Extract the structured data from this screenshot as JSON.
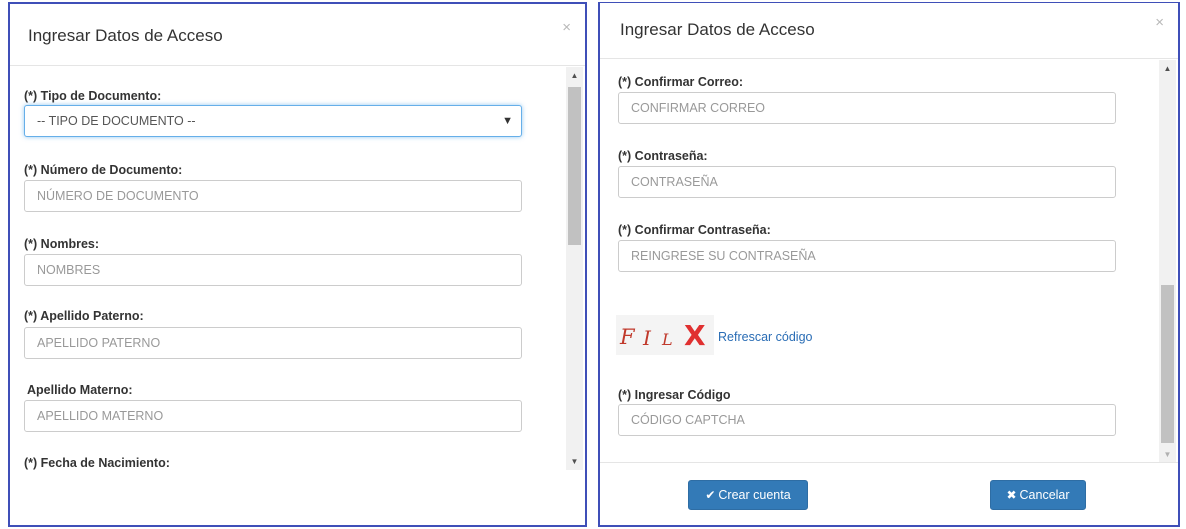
{
  "left_modal": {
    "title": "Ingresar Datos de Acceso",
    "close_glyph": "×",
    "fields": [
      {
        "label": "(*) Tipo de Documento:",
        "placeholder": "-- TIPO DE DOCUMENTO --"
      },
      {
        "label": "(*) Número de Documento:",
        "placeholder": "NÚMERO DE DOCUMENTO"
      },
      {
        "label": "(*) Nombres:",
        "placeholder": "NOMBRES"
      },
      {
        "label": "(*) Apellido Paterno:",
        "placeholder": "APELLIDO PATERNO"
      },
      {
        "label": "Apellido Materno:",
        "placeholder": "APELLIDO MATERNO"
      },
      {
        "label": "(*) Fecha de Nacimiento:",
        "placeholder": ""
      }
    ],
    "select_caret": "▼"
  },
  "right_modal": {
    "title": "Ingresar Datos de Acceso",
    "close_glyph": "×",
    "fields": [
      {
        "label": "(*) Confirmar Correo:",
        "placeholder": "CONFIRMAR CORREO"
      },
      {
        "label": "(*) Contraseña:",
        "placeholder": "CONTRASEÑA"
      },
      {
        "label": "(*) Confirmar Contraseña:",
        "placeholder": "REINGRESE SU CONTRASEÑA"
      }
    ],
    "captcha": {
      "chars": [
        "F",
        "I",
        "L",
        "X"
      ],
      "refresh_label": "Refrescar código"
    },
    "code_field": {
      "label": "(*) Ingresar Código",
      "placeholder": "CÓDIGO CAPTCHA"
    },
    "buttons": {
      "create_icon": "✔",
      "create_label": "Crear cuenta",
      "cancel_icon": "✖",
      "cancel_label": "Cancelar"
    }
  },
  "scroll_icons": {
    "up": "▲",
    "down": "▼"
  },
  "colors": {
    "primary": "#337ab7",
    "modal_border": "#3f4fb8",
    "link": "#2a6db5",
    "captcha": "#c0392b"
  }
}
